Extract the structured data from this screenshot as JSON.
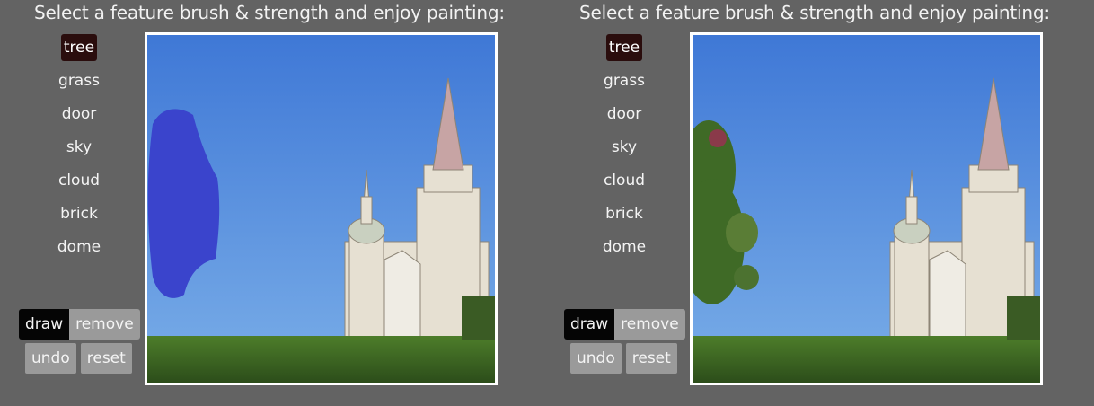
{
  "panels": [
    {
      "title": "Select a feature brush & strength and enjoy painting:",
      "features": [
        "tree",
        "grass",
        "door",
        "sky",
        "cloud",
        "brick",
        "dome"
      ],
      "active_feature": "tree",
      "buttons": {
        "draw": "draw",
        "remove": "remove",
        "undo": "undo",
        "reset": "reset"
      }
    },
    {
      "title": "Select a feature brush & strength and enjoy painting:",
      "features": [
        "tree",
        "grass",
        "door",
        "sky",
        "cloud",
        "brick",
        "dome"
      ],
      "active_feature": "tree",
      "buttons": {
        "draw": "draw",
        "remove": "remove",
        "undo": "undo",
        "reset": "reset"
      }
    }
  ],
  "colors": {
    "background": "#636363",
    "active_feature_bg": "#2a0d0d",
    "draw_bg": "#050505",
    "button_gray": "#9a9a9a",
    "brush_stroke": "#3a44cc",
    "sky": "#4a82dc"
  }
}
